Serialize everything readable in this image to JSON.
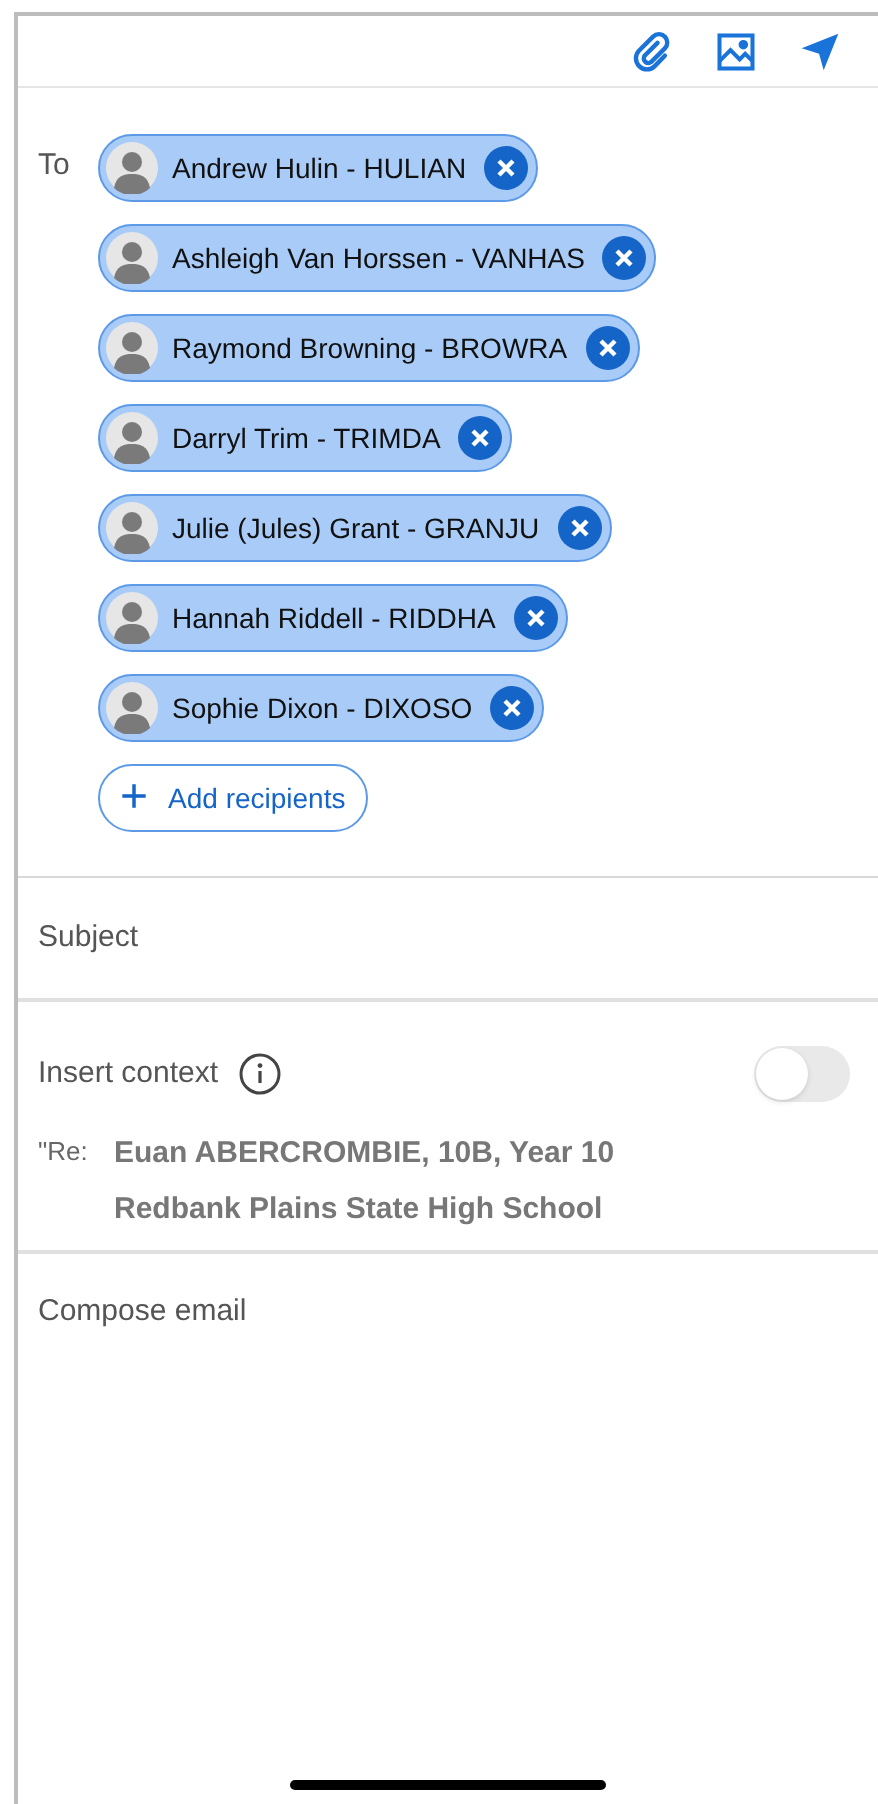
{
  "to_label": "To",
  "recipients": [
    {
      "name": "Andrew Hulin - HULIAN"
    },
    {
      "name": "Ashleigh Van Horssen - VANHAS"
    },
    {
      "name": "Raymond Browning - BROWRA"
    },
    {
      "name": "Darryl Trim - TRIMDA"
    },
    {
      "name": "Julie (Jules) Grant - GRANJU"
    },
    {
      "name": "Hannah Riddell - RIDDHA"
    },
    {
      "name": "Sophie Dixon - DIXOSO"
    }
  ],
  "add_recipients": {
    "icon": "+",
    "label": "Add recipients"
  },
  "subject": {
    "placeholder": "Subject"
  },
  "insert_context": {
    "label": "Insert context",
    "on": false
  },
  "context": {
    "prefix": "\"Re:",
    "lines": [
      "Euan ABERCROMBIE, 10B, Year 10",
      "Redbank Plains State High School"
    ]
  },
  "body": {
    "placeholder": "Compose email"
  }
}
